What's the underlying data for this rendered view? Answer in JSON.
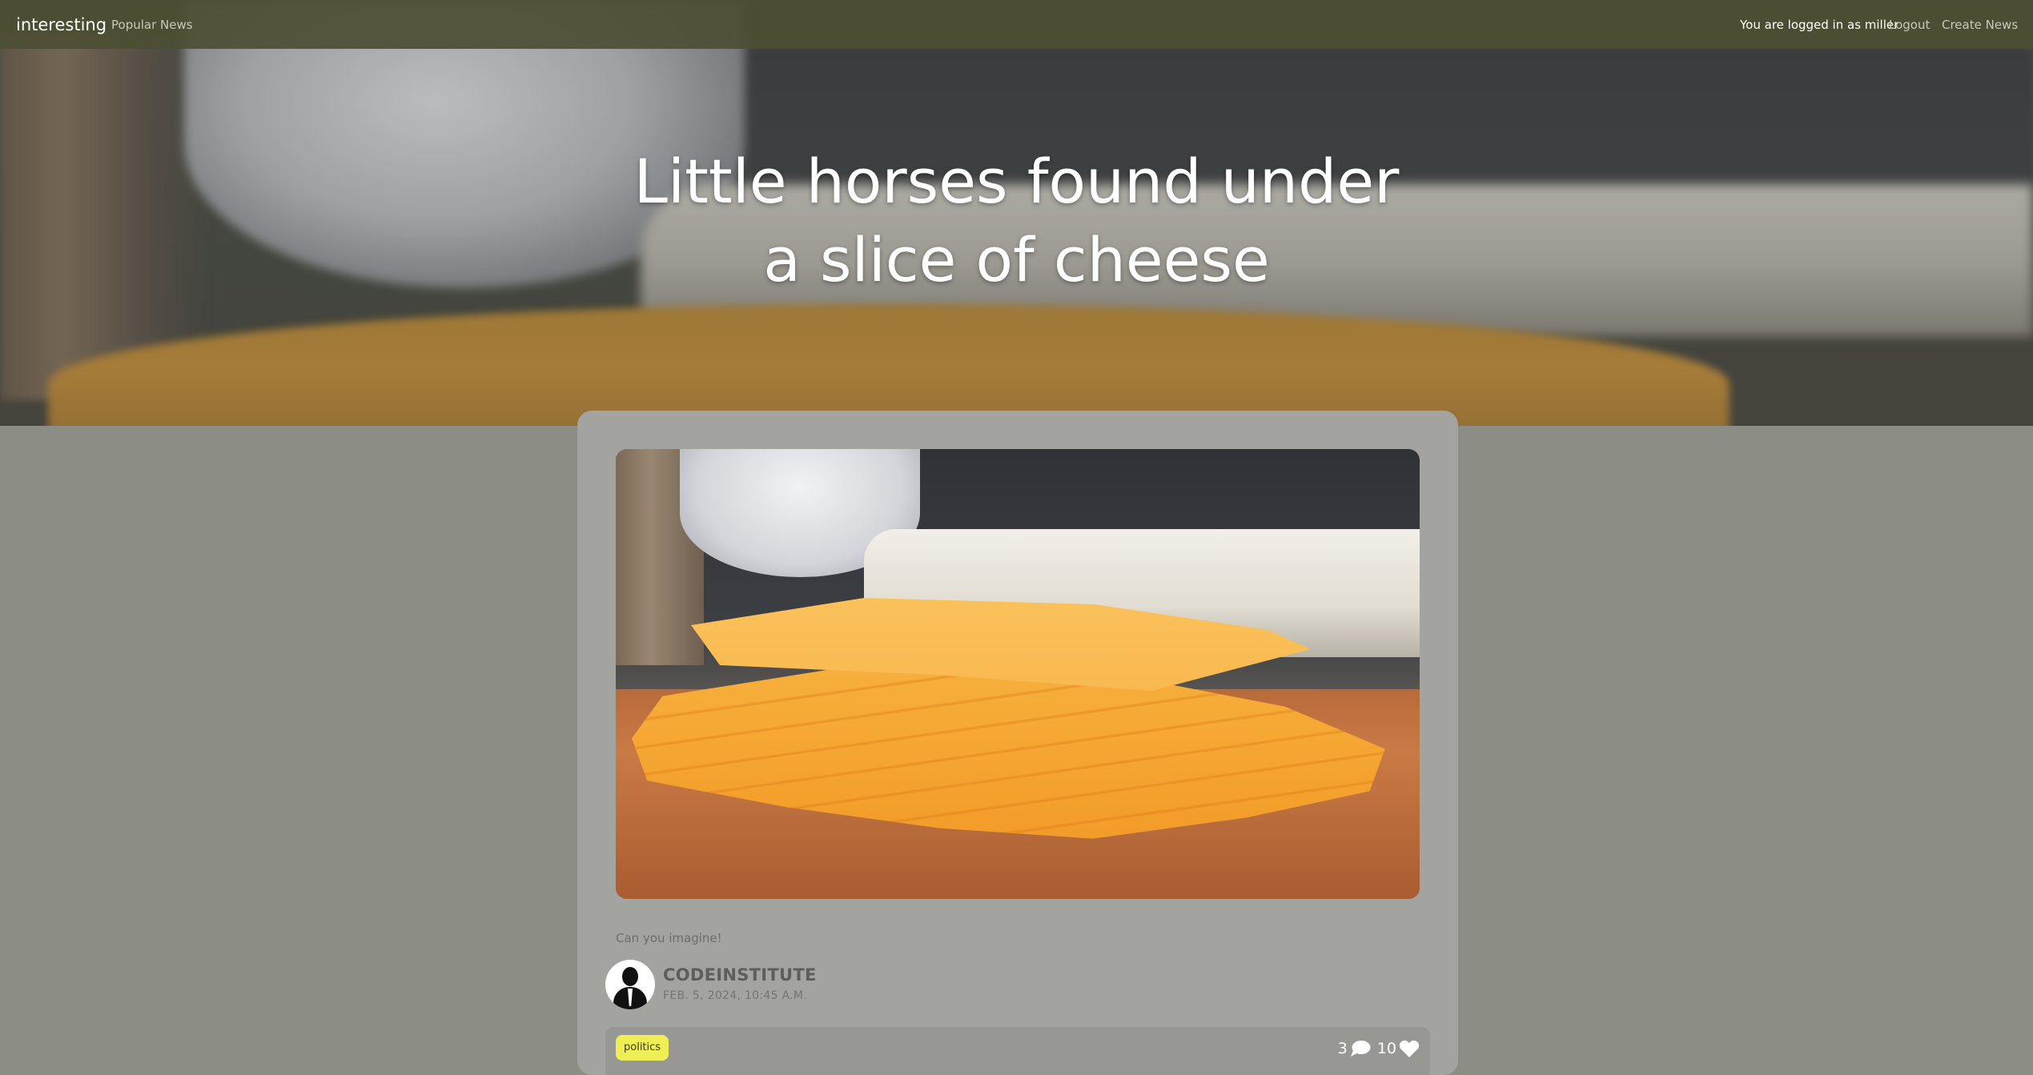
{
  "navbar": {
    "brand": "interesting",
    "popular_news": "Popular News",
    "logged_in_text": "You are logged in as miller",
    "logout": "Logout",
    "create_news": "Create News",
    "background_color": "#4c4f34"
  },
  "hero": {
    "title": "Little horses found under a slice of cheese"
  },
  "post": {
    "caption": "Can you imagine!",
    "author": "CODEINSTITUTE",
    "date": "FEB. 5, 2024, 10:45 A.M.",
    "tag": "politics",
    "tag_color": "#f0ee55",
    "comment_count": "3",
    "like_count": "10",
    "comment_icon": "comment-icon",
    "like_icon": "heart-icon",
    "avatar_icon": "user-silhouette-icon",
    "image_subject": "stack of cheddar cheese slices"
  },
  "colors": {
    "page_background": "#8c8d85",
    "card_background": "#a3a39f"
  }
}
